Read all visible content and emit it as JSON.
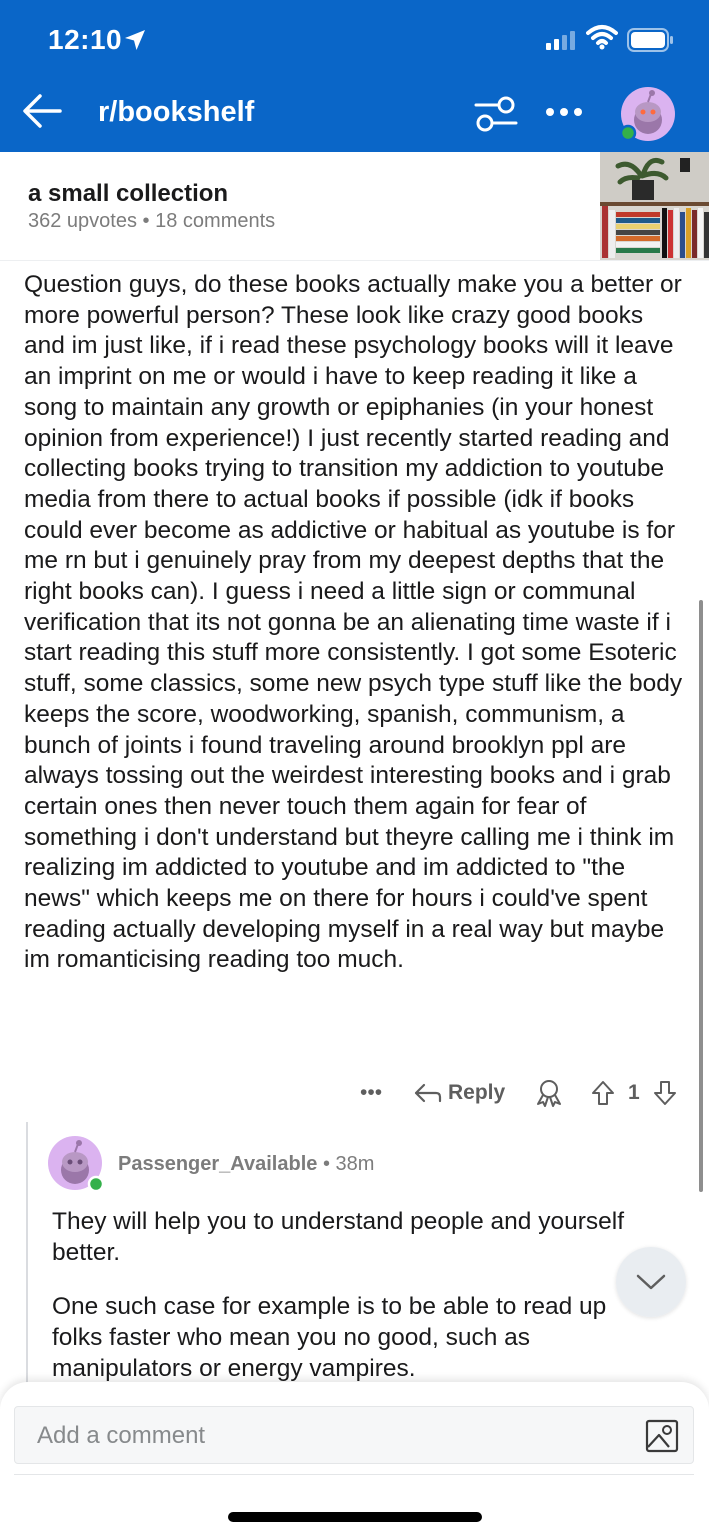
{
  "status_bar": {
    "time": "12:10"
  },
  "header": {
    "subreddit": "r/bookshelf"
  },
  "post": {
    "title": "a small collection",
    "upvotes": "362 upvotes",
    "separator": "•",
    "comments": "18 comments",
    "body": "Question guys, do these books actually make you a better or more powerful person? These look like crazy good books and im just like, if i read these psychology books will it leave an imprint on me or would i have to keep reading it like a song to maintain any growth or epiphanies (in your honest opinion from experience!) I just recently started reading and collecting books trying to transition my addiction to youtube media from there to actual books if possible (idk if books could ever become as addictive or habitual as youtube is for me rn but i genuinely pray from my deepest depths that the right books can). I guess i need a little sign or communal verification that its not gonna be an alienating time waste if i start reading this stuff more consistently. I got some Esoteric stuff, some classics, some new psych type stuff like the body keeps the score, woodworking, spanish, communism, a bunch of joints i found traveling around brooklyn ppl are always tossing out the weirdest interesting books and i grab certain ones then never touch them again for fear of something i don't understand but theyre calling me i think im realizing im addicted to youtube and im addicted to \"the news\" which keeps me on there for hours i could've spent reading actually developing myself in a real way but maybe im romanticising reading too much."
  },
  "actions": {
    "more": "•••",
    "reply": "Reply",
    "vote_count": "1"
  },
  "comment": {
    "author": "Passenger_Available",
    "separator": "•",
    "age": "38m",
    "paragraph1": "They will help you to understand people and yourself better.",
    "paragraph2": "One such case for example is to be able to read up folks faster who mean you no good, such as manipulators or energy vampires."
  },
  "composer": {
    "placeholder": "Add a comment"
  },
  "colors": {
    "header_bg": "#0a66c8",
    "avatar_bg": "#dbb3f0",
    "online": "#34b04a"
  }
}
